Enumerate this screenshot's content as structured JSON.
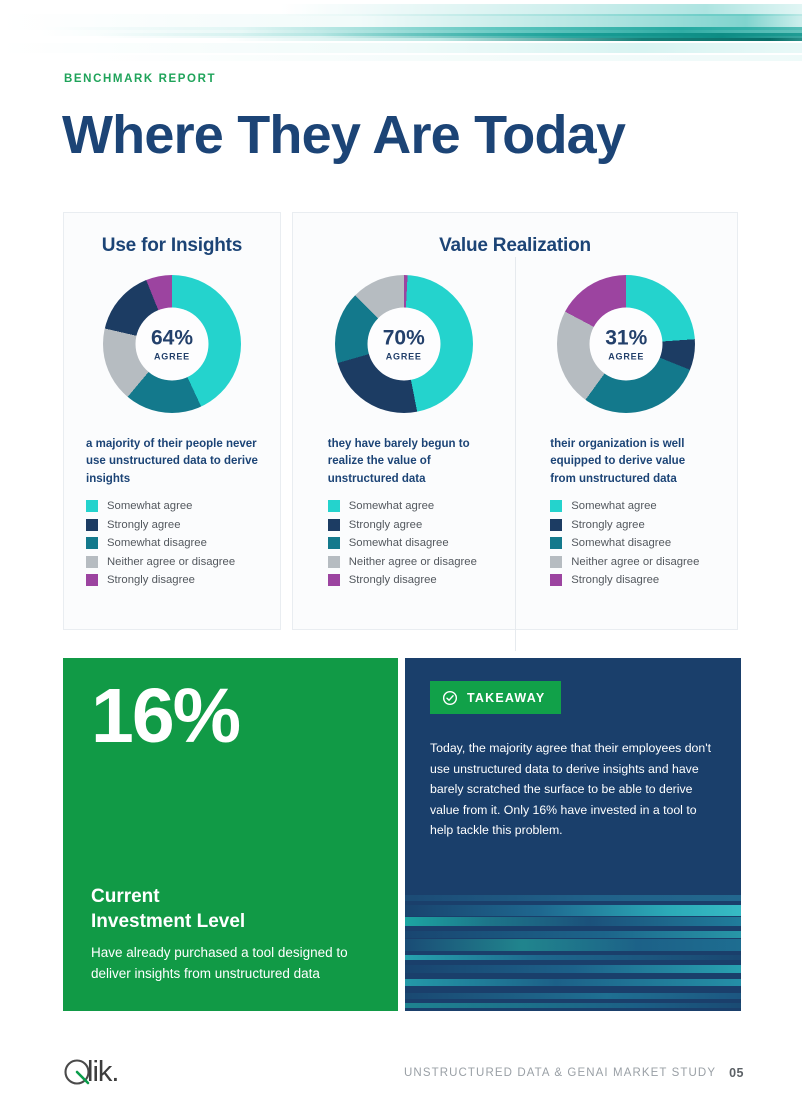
{
  "header": {
    "eyebrow": "BENCHMARK REPORT",
    "headline": "Where They Are Today",
    "eyebrow_color": "#1fa35a",
    "headline_color": "#1c4476"
  },
  "palette": {
    "somewhat_agree": "#24d3cd",
    "strongly_agree": "#1c3c63",
    "somewhat_disagree": "#13798c",
    "neither": "#b6bcc1",
    "strongly_disagree": "#9c44a0",
    "green": "#119a46",
    "dark_navy": "#1a3f6b"
  },
  "cards": [
    {
      "title": "Use for Insights"
    },
    {
      "title": "Value Realization"
    }
  ],
  "legend_labels": [
    "Somewhat agree",
    "Strongly agree",
    "Somewhat disagree",
    "Neither agree or disagree",
    "Strongly disagree"
  ],
  "charts": [
    {
      "center_value": "64%",
      "center_sub": "AGREE",
      "caption": "a majority of their people never use unstructured data to derive insights"
    },
    {
      "center_value": "70%",
      "center_sub": "AGREE",
      "caption": "they have barely begun to realize the value of unstructured data"
    },
    {
      "center_value": "31%",
      "center_sub": "AGREE",
      "caption": "their organization is well equipped to derive value from unstructured data"
    }
  ],
  "green_panel": {
    "big_number": "16%",
    "title": "Current\nInvestment Level",
    "title_line1": "Current",
    "title_line2": "Investment Level",
    "body": "Have already purchased a tool designed to deliver insights from unstructured data"
  },
  "takeaway": {
    "badge_label": "TAKEAWAY",
    "badge_icon": "check-circle-icon",
    "body": "Today, the majority agree that their employees don't use unstructured data to derive insights and have barely scratched the surface to be able to derive value from it. Only 16% have invested in a tool to help tackle this problem."
  },
  "footer": {
    "logo": "Qlik.",
    "study": "UNSTRUCTURED DATA & GENAI MARKET STUDY",
    "page": "05"
  },
  "chart_data": [
    {
      "type": "pie",
      "title": "Use for Insights",
      "center_label": "64% AGREE",
      "categories": [
        "Somewhat agree",
        "Strongly agree",
        "Somewhat disagree",
        "Neither agree or disagree",
        "Strongly disagree"
      ],
      "values": [
        43,
        21,
        18,
        12,
        6
      ],
      "colors": [
        "#24d3cd",
        "#1c3c63",
        "#13798c",
        "#b6bcc1",
        "#9c44a0"
      ],
      "legend": "below",
      "note": "donut; starts at 12 o'clock clockwise"
    },
    {
      "type": "pie",
      "title": "Value Realization (barely begun)",
      "center_label": "70% AGREE",
      "categories": [
        "Somewhat agree",
        "Strongly agree",
        "Somewhat disagree",
        "Neither agree or disagree",
        "Strongly disagree"
      ],
      "values": [
        46,
        24,
        17,
        12,
        1
      ],
      "colors": [
        "#24d3cd",
        "#1c3c63",
        "#13798c",
        "#b6bcc1",
        "#9c44a0"
      ],
      "legend": "below",
      "note": "donut; starts at 12 o'clock clockwise"
    },
    {
      "type": "pie",
      "title": "Value Realization (well equipped)",
      "center_label": "31% AGREE",
      "categories": [
        "Somewhat agree",
        "Strongly agree",
        "Somewhat disagree",
        "Neither agree or disagree",
        "Strongly disagree"
      ],
      "values": [
        24,
        7,
        29,
        23,
        17
      ],
      "colors": [
        "#24d3cd",
        "#1c3c63",
        "#13798c",
        "#b6bcc1",
        "#9c44a0"
      ],
      "legend": "below",
      "note": "donut; starts at 12 o'clock clockwise"
    }
  ]
}
